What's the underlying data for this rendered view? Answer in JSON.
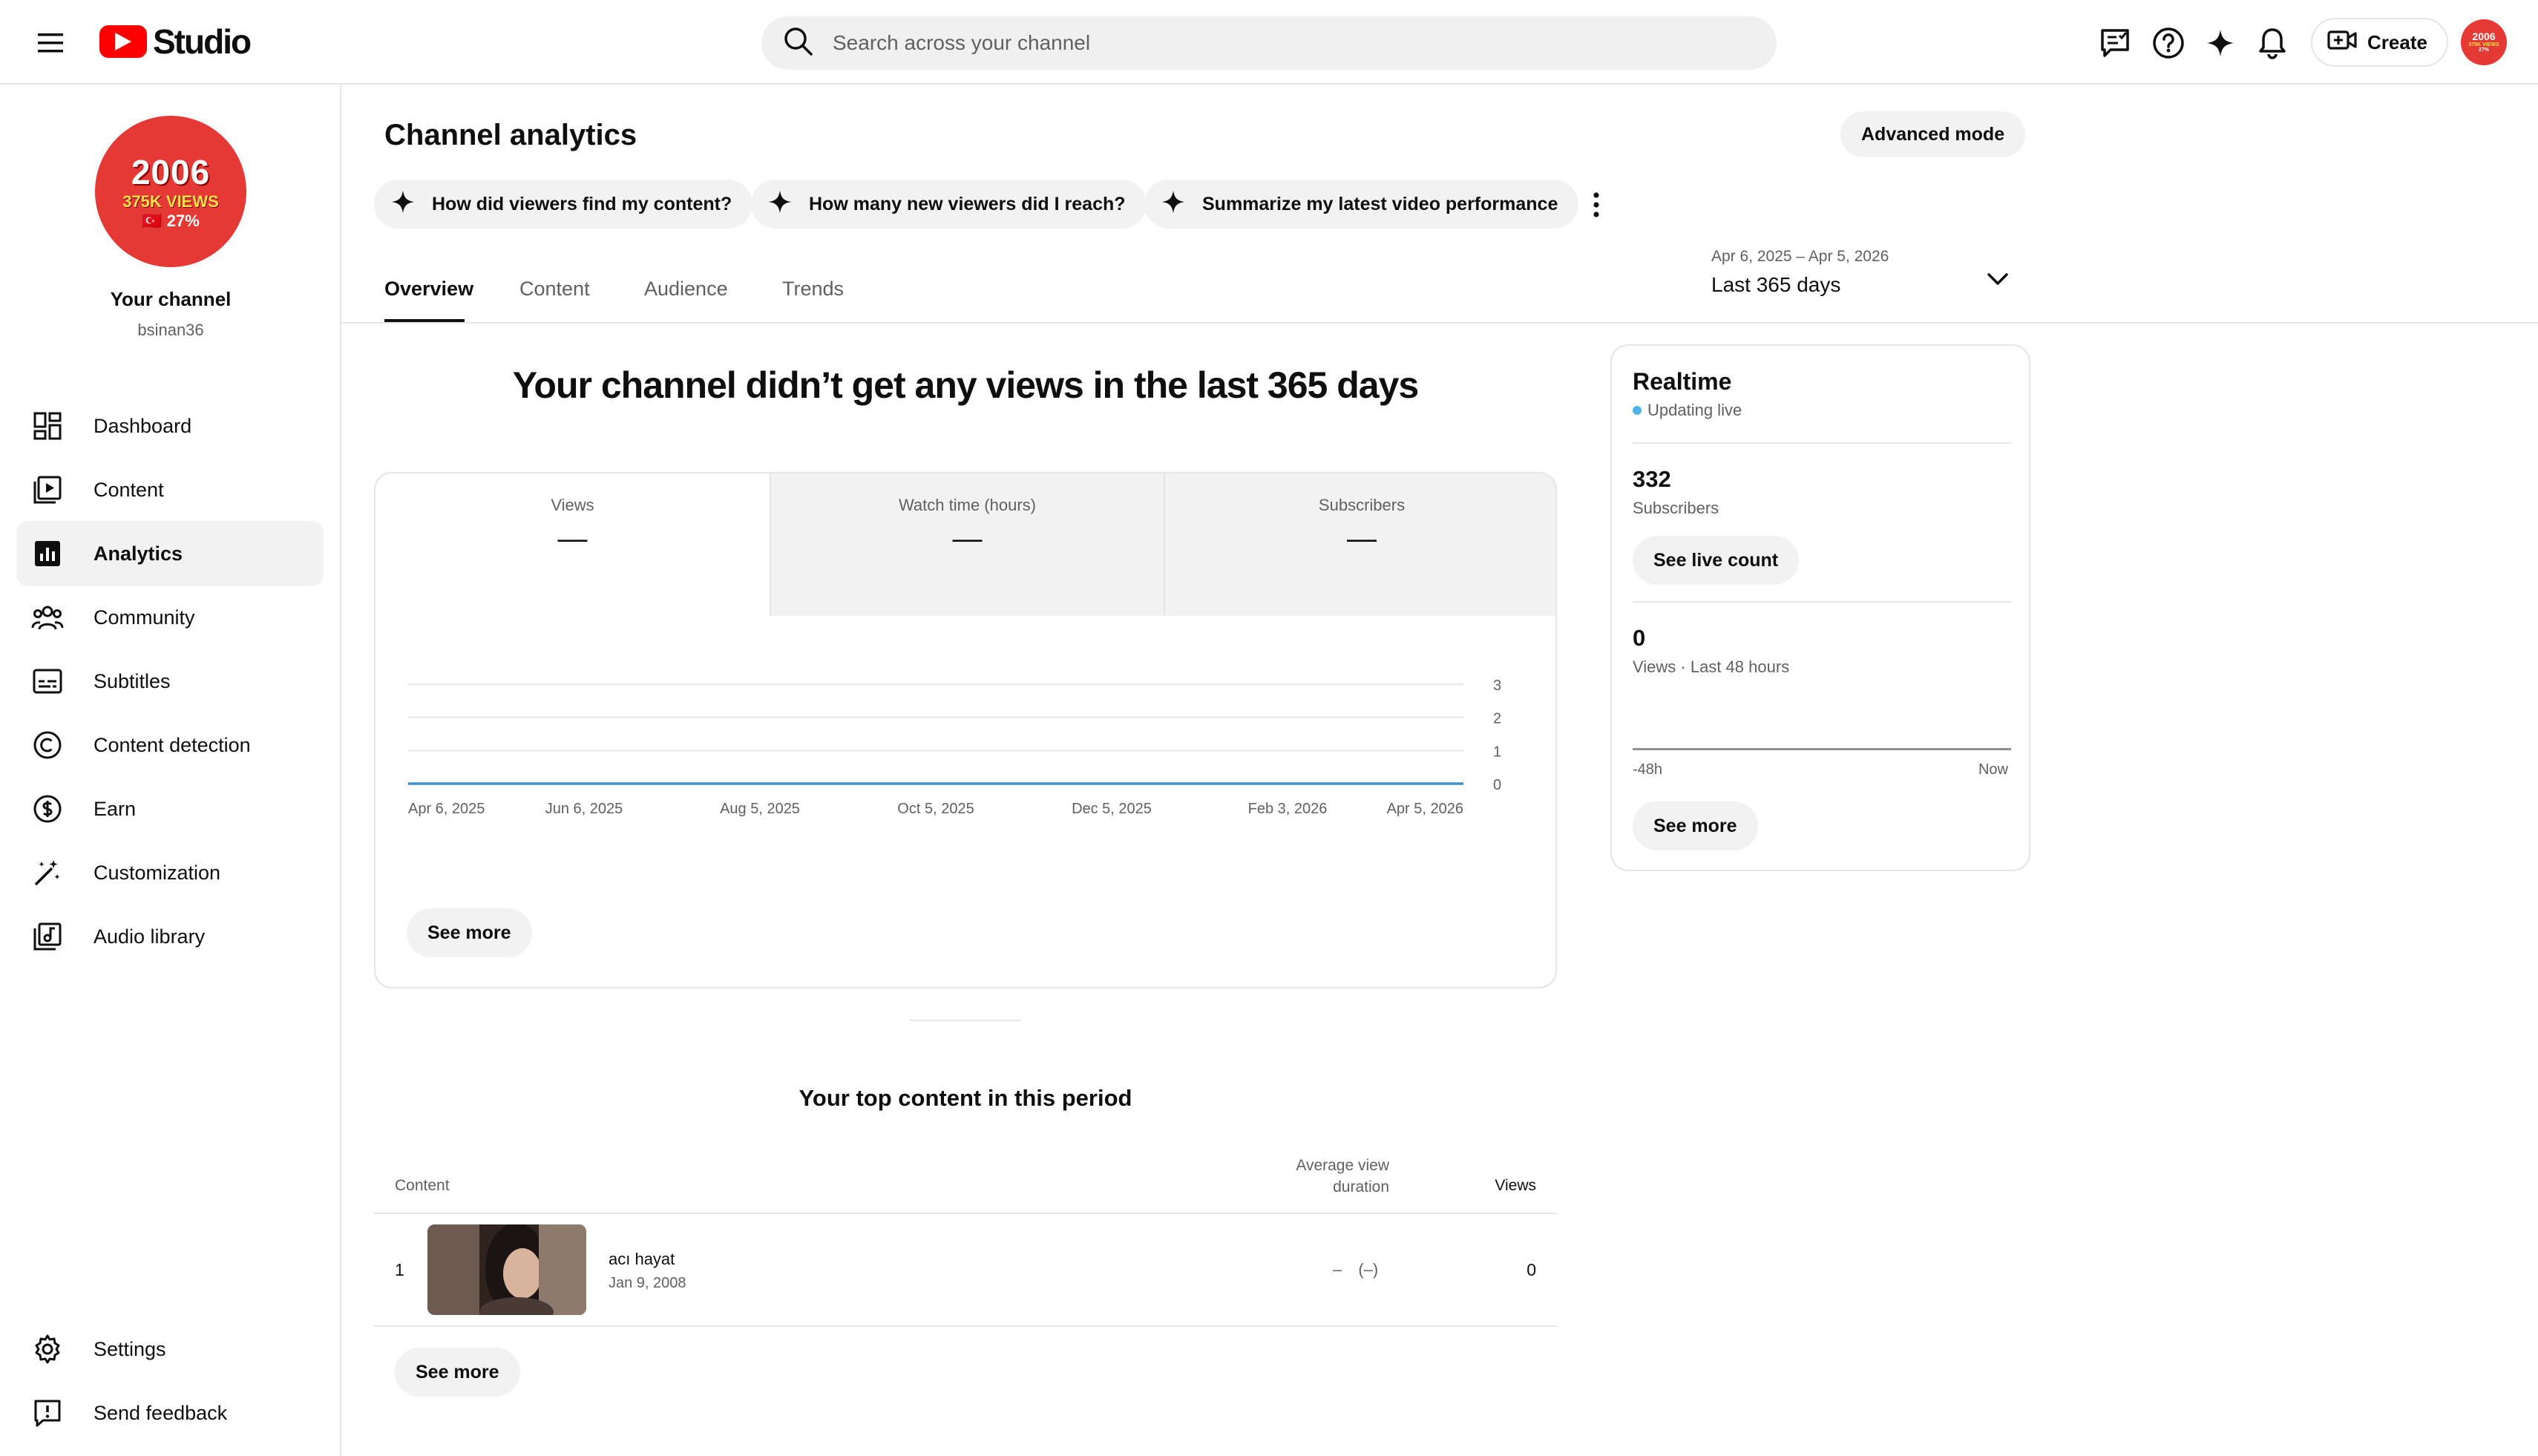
{
  "header": {
    "logo_text": "Studio",
    "search_placeholder": "Search across your channel",
    "create_label": "Create",
    "avatar_text": [
      "2006",
      "375K VIEWS",
      "27%"
    ]
  },
  "sidebar": {
    "channel_name": "Your channel",
    "channel_handle": "bsinan36",
    "avatar_lines": [
      "2006",
      "375K VIEWS",
      "🇹🇷 27%"
    ],
    "items": [
      {
        "label": "Dashboard",
        "icon": "dashboard-icon",
        "active": false
      },
      {
        "label": "Content",
        "icon": "content-icon",
        "active": false
      },
      {
        "label": "Analytics",
        "icon": "analytics-icon",
        "active": true
      },
      {
        "label": "Community",
        "icon": "community-icon",
        "active": false
      },
      {
        "label": "Subtitles",
        "icon": "subtitles-icon",
        "active": false
      },
      {
        "label": "Content detection",
        "icon": "copyright-icon",
        "active": false
      },
      {
        "label": "Earn",
        "icon": "dollar-icon",
        "active": false
      },
      {
        "label": "Customization",
        "icon": "magic-wand-icon",
        "active": false
      },
      {
        "label": "Audio library",
        "icon": "audio-library-icon",
        "active": false
      }
    ],
    "bottom_items": [
      {
        "label": "Settings",
        "icon": "gear-icon"
      },
      {
        "label": "Send feedback",
        "icon": "feedback-icon"
      }
    ]
  },
  "main": {
    "title": "Channel analytics",
    "advanced_mode": "Advanced mode",
    "chips": [
      "How did viewers find my content?",
      "How many new viewers did I reach?",
      "Summarize my latest video performance"
    ],
    "tabs": [
      "Overview",
      "Content",
      "Audience",
      "Trends"
    ],
    "active_tab": "Overview",
    "date_range": "Apr 6, 2025 – Apr 5, 2026",
    "date_label": "Last 365 days",
    "headline": "Your channel didn’t get any views in the last 365 days",
    "metrics": [
      {
        "label": "Views",
        "value": "—"
      },
      {
        "label": "Watch time (hours)",
        "value": "—"
      },
      {
        "label": "Subscribers",
        "value": "—"
      }
    ],
    "see_more": "See more",
    "top_content": {
      "title": "Your top content in this period",
      "col_content": "Content",
      "col_avd_line1": "Average view",
      "col_avd_line2": "duration",
      "col_views": "Views",
      "rows": [
        {
          "rank": "1",
          "title": "acı hayat",
          "date": "Jan 9, 2008",
          "avd": "–",
          "avd_pct": "(–)",
          "views": "0"
        }
      ],
      "see_more": "See more"
    }
  },
  "chart_data": {
    "type": "line",
    "x": [
      "Apr 6, 2025",
      "Jun 6, 2025",
      "Aug 5, 2025",
      "Oct 5, 2025",
      "Dec 5, 2025",
      "Feb 3, 2026",
      "Apr 5, 2026"
    ],
    "series": [
      {
        "values": [
          0,
          0,
          0,
          0,
          0,
          0,
          0
        ]
      }
    ],
    "ylim": [
      0,
      3
    ],
    "yticks": [
      0,
      1,
      2,
      3
    ],
    "grid": true,
    "line_color": "#3f8fd2"
  },
  "realtime": {
    "title": "Realtime",
    "status": "Updating live",
    "subscribers": "332",
    "subscribers_label": "Subscribers",
    "live_count_btn": "See live count",
    "views": "0",
    "views_label": "Views · Last 48 hours",
    "axis_start": "-48h",
    "axis_end": "Now",
    "see_more": "See more"
  }
}
